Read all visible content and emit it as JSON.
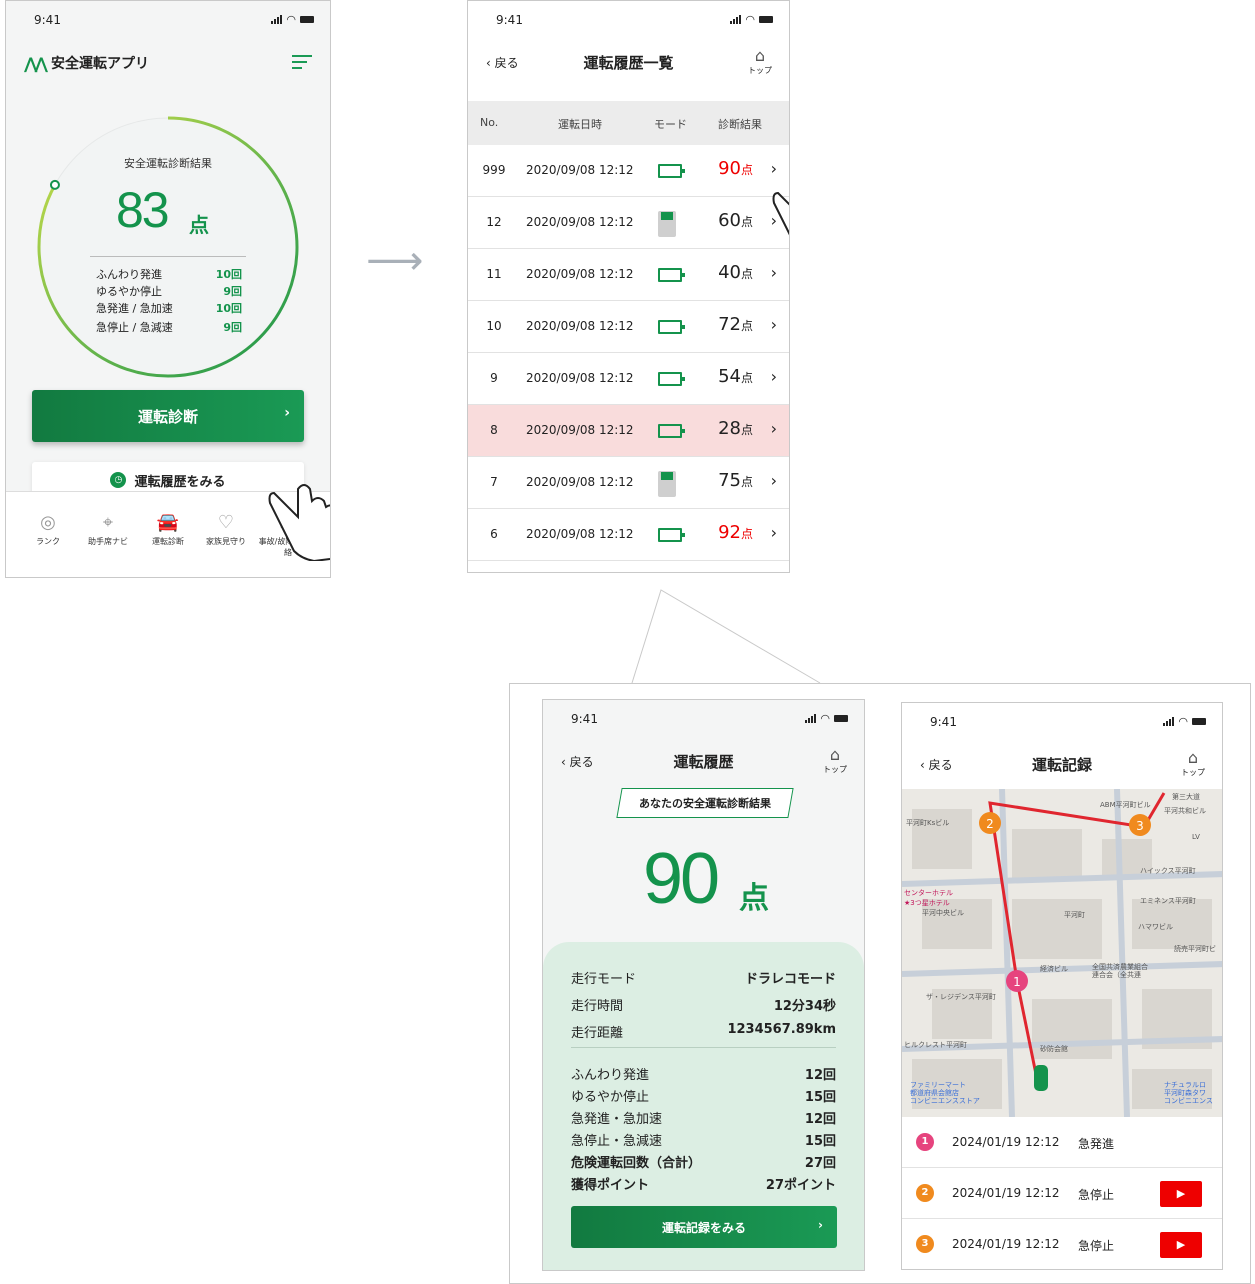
{
  "status_time": "9:41",
  "home_screen": {
    "app_name": "安全運転アプリ",
    "gauge_title": "安全運転診断結果",
    "score": "83",
    "score_unit": "点",
    "score_fraction": 0.83,
    "stats": [
      {
        "label": "ふんわり発進",
        "value": "10回"
      },
      {
        "label": "ゆるやか停止",
        "value": "9回"
      },
      {
        "label": "急発進 / 急加速",
        "value": "10回"
      },
      {
        "label": "急停止 / 急減速",
        "value": "9回"
      }
    ],
    "diagnose_button": "運転診断",
    "history_button": "運転履歴をみる",
    "tabs": [
      "ランク",
      "助手席ナビ",
      "運転診断",
      "家族見守り",
      "事故/故障のご連絡"
    ]
  },
  "history_list": {
    "back": "戻る",
    "title": "運転履歴一覧",
    "home_label": "トップ",
    "headers": [
      "No.",
      "運転日時",
      "モード",
      "診断結果"
    ],
    "score_unit": "点",
    "rows": [
      {
        "no": "999",
        "date": "2020/09/08 12:12",
        "mode": "camera",
        "score": "90",
        "red": true,
        "highlight": false
      },
      {
        "no": "12",
        "date": "2020/09/08 12:12",
        "mode": "device",
        "score": "60",
        "red": false,
        "highlight": false
      },
      {
        "no": "11",
        "date": "2020/09/08 12:12",
        "mode": "camera",
        "score": "40",
        "red": false,
        "highlight": false
      },
      {
        "no": "10",
        "date": "2020/09/08 12:12",
        "mode": "camera",
        "score": "72",
        "red": false,
        "highlight": false
      },
      {
        "no": "9",
        "date": "2020/09/08 12:12",
        "mode": "camera",
        "score": "54",
        "red": false,
        "highlight": false
      },
      {
        "no": "8",
        "date": "2020/09/08 12:12",
        "mode": "camera",
        "score": "28",
        "red": false,
        "highlight": true
      },
      {
        "no": "7",
        "date": "2020/09/08 12:12",
        "mode": "device",
        "score": "75",
        "red": false,
        "highlight": false
      },
      {
        "no": "6",
        "date": "2020/09/08 12:12",
        "mode": "camera",
        "score": "92",
        "red": true,
        "highlight": false
      }
    ]
  },
  "history_detail": {
    "back": "戻る",
    "title": "運転履歴",
    "home_label": "トップ",
    "badge": "あなたの安全運転診断結果",
    "score": "90",
    "score_unit": "点",
    "info": [
      {
        "label": "走行モード",
        "value": "ドラレコモード"
      },
      {
        "label": "走行時間",
        "value": "12分34秒"
      },
      {
        "label": "走行距離",
        "value": "1234567.89km"
      }
    ],
    "counts": [
      {
        "label": "ふんわり発進",
        "value": "12回",
        "bold": false
      },
      {
        "label": "ゆるやか停止",
        "value": "15回",
        "bold": false
      },
      {
        "label": "急発進・急加速",
        "value": "12回",
        "bold": false
      },
      {
        "label": "急停止・急減速",
        "value": "15回",
        "bold": false
      },
      {
        "label": "危険運転回数（合計）",
        "value": "27回",
        "bold": true
      },
      {
        "label": "獲得ポイント",
        "value": "27ポイント",
        "bold": true
      }
    ],
    "record_button": "運転記録をみる"
  },
  "drive_record": {
    "back": "戻る",
    "title": "運転記録",
    "home_label": "トップ",
    "map_labels": [
      "ABM平河町ビル",
      "第三大道",
      "平河共和ビル",
      "平河町Ksビル",
      "LV",
      "ハイックス平河町",
      "センターホテル",
      "★3つ星ホテル",
      "エミネンス平河町",
      "平河中央ビル",
      "平河町",
      "ハマワビル",
      "読売平河町ビ",
      "経済ビル",
      "全国共済農業組合",
      "連合会（全共連",
      "ザ・レジデンス平河町",
      "ヒルクレスト平河町",
      "砂防会館",
      "ファミリーマート",
      "都道府県会館店",
      "コンビニエンスストア",
      "ナチュラルロ",
      "平河町森タワ",
      "コンビニエンス"
    ],
    "events": [
      {
        "num": "1",
        "color": "#e6447e",
        "date": "2024/01/19 12:12",
        "type": "急発進",
        "video": false
      },
      {
        "num": "2",
        "color": "#f08a1e",
        "date": "2024/01/19 12:12",
        "type": "急停止",
        "video": true
      },
      {
        "num": "3",
        "color": "#f08a1e",
        "date": "2024/01/19 12:12",
        "type": "急停止",
        "video": true
      }
    ]
  }
}
